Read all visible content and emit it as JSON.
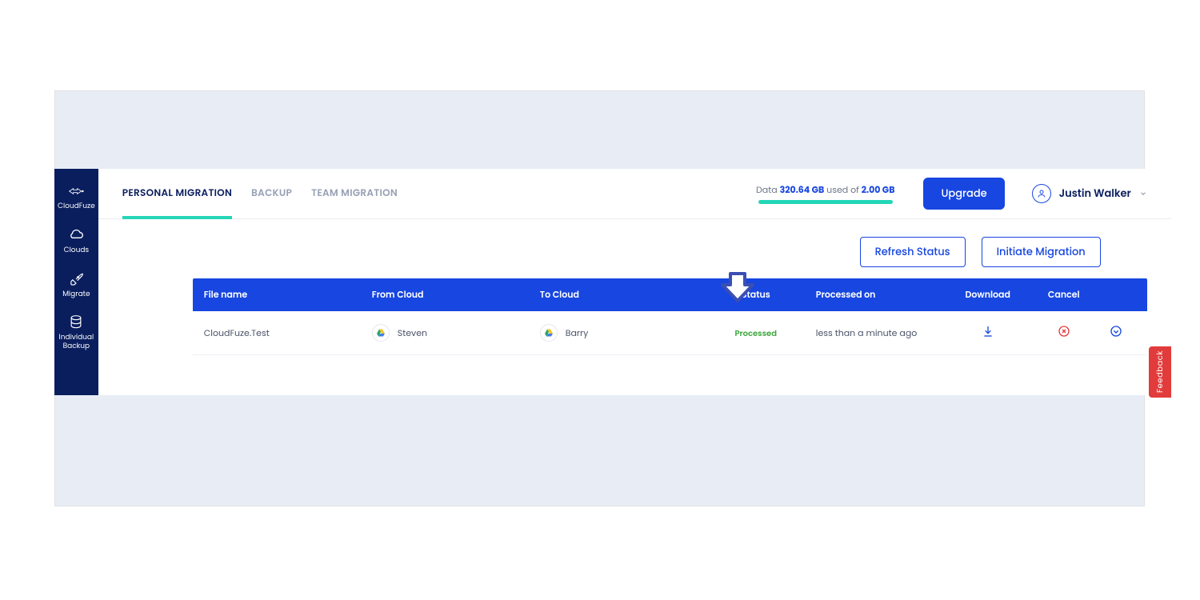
{
  "sidebar": {
    "brand": "CloudFuze",
    "items": [
      {
        "label": "Clouds"
      },
      {
        "label": "Migrate"
      },
      {
        "label": "Individual Backup"
      }
    ]
  },
  "tabs": [
    {
      "label": "PERSONAL MIGRATION",
      "active": true
    },
    {
      "label": "BACKUP",
      "active": false
    },
    {
      "label": "TEAM MIGRATION",
      "active": false
    }
  ],
  "usage": {
    "prefix": "Data ",
    "used": "320.64 GB",
    "mid": " used of ",
    "total": "2.00 GB"
  },
  "buttons": {
    "upgrade": "Upgrade",
    "refresh": "Refresh Status",
    "initiate": "Initiate Migration"
  },
  "user": {
    "name": "Justin Walker"
  },
  "table": {
    "headers": {
      "file": "File name",
      "from": "From Cloud",
      "to": "To Cloud",
      "status": "Status",
      "processed": "Processed on",
      "download": "Download",
      "cancel": "Cancel"
    },
    "rows": [
      {
        "file": "CloudFuze.Test",
        "from": "Steven",
        "to": "Barry",
        "status": "Processed",
        "processed": "less than a minute ago"
      }
    ]
  },
  "feedback": "Feedback"
}
